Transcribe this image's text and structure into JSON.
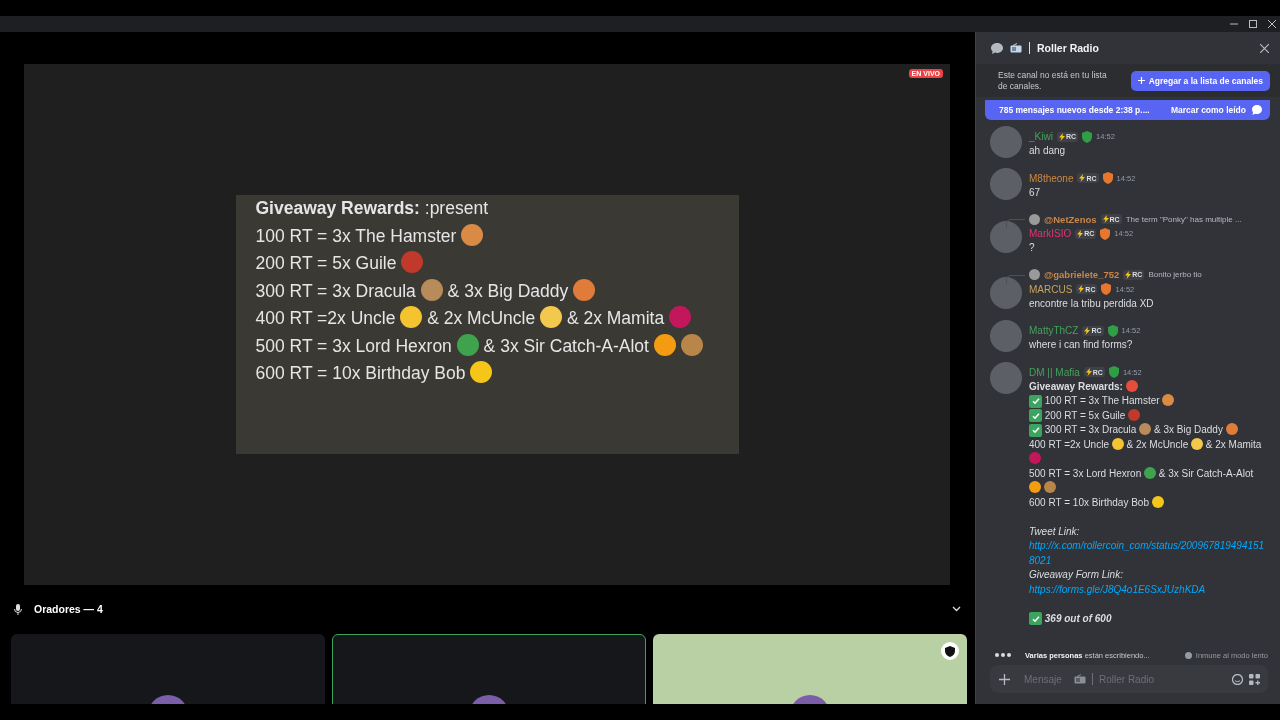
{
  "stage": {
    "live_badge": "EN VIVO",
    "lines": [
      [
        {
          "kind": "bold",
          "text": "Giveaway Rewards:"
        },
        {
          "kind": "text",
          "text": ":present"
        }
      ],
      [
        {
          "kind": "text",
          "text": "100 RT = 3x The Hamster"
        },
        {
          "kind": "emoji",
          "color": "#d98a45"
        }
      ],
      [
        {
          "kind": "text",
          "text": "200 RT = 5x Guile"
        },
        {
          "kind": "emoji",
          "color": "#c0392b"
        }
      ],
      [
        {
          "kind": "text",
          "text": "300 RT = 3x Dracula"
        },
        {
          "kind": "emoji",
          "color": "#b98a5a"
        },
        {
          "kind": "text",
          "text": "& 3x Big Daddy"
        },
        {
          "kind": "emoji",
          "color": "#e07b39"
        }
      ],
      [
        {
          "kind": "text",
          "text": "400 RT =2x Uncle"
        },
        {
          "kind": "emoji",
          "color": "#f4c430"
        },
        {
          "kind": "text",
          "text": "&  2x McUncle"
        },
        {
          "kind": "emoji",
          "color": "#f2c94c"
        },
        {
          "kind": "text",
          "text": "& 2x Mamita"
        },
        {
          "kind": "emoji",
          "color": "#c2185b"
        }
      ],
      [
        {
          "kind": "text",
          "text": "500 RT = 3x Lord Hexron"
        },
        {
          "kind": "emoji",
          "color": "#3fa34d"
        },
        {
          "kind": "text",
          "text": "& 3x Sir Catch-A-Alot"
        },
        {
          "kind": "emoji",
          "color": "#f39c12"
        },
        {
          "kind": "emoji",
          "color": "#b9864a"
        }
      ],
      [
        {
          "kind": "text",
          "text": "600 RT = 10x Birthday Bob"
        },
        {
          "kind": "emoji",
          "color": "#f5c518"
        }
      ]
    ]
  },
  "speakers": {
    "label": "Oradores — 4",
    "tiles": [
      {
        "speaking": false,
        "moderator": false,
        "color": "#16171b"
      },
      {
        "speaking": true,
        "moderator": false,
        "color": "#16171b"
      },
      {
        "speaking": false,
        "moderator": true,
        "color": "#b9d0a5"
      }
    ]
  },
  "chat": {
    "channel": "Roller Radio",
    "notice": "Este canal no está en tu lista de canales.",
    "add_button": "Agregar a la lista de canales",
    "new_messages": "785 mensajes nuevos desde 2:38 p....",
    "mark_read": "Marcar como leído",
    "messages": [
      {
        "author": "_Kiwi",
        "color": "#43a25a",
        "tag": "RC",
        "badge": {
          "color": "#2f9e44"
        },
        "time": "14:52",
        "lines": [
          [
            {
              "kind": "text",
              "text": "ah dang"
            }
          ]
        ]
      },
      {
        "author": "M8theone",
        "color": "#d0883f",
        "tag": "RC",
        "badge": {
          "color": "#e8772e"
        },
        "time": "14:52",
        "lines": [
          [
            {
              "kind": "text",
              "text": "67"
            }
          ]
        ]
      },
      {
        "author": "MarkISIO",
        "color": "#e0356e",
        "tag": "RC",
        "badge": {
          "color": "#e8772e"
        },
        "time": "14:52",
        "reply": {
          "author": "@NetZenos",
          "color": "#c8874a",
          "tag": "RC",
          "text": "The term \"Ponky\" has multiple ..."
        },
        "lines": [
          [
            {
              "kind": "text",
              "text": "?"
            }
          ]
        ]
      },
      {
        "author": "MARCUS",
        "color": "#c9a25b",
        "tag": "RC",
        "badge": {
          "color": "#e8772e"
        },
        "time": "14:52",
        "reply": {
          "author": "@gabrielete_752",
          "color": "#c8874a",
          "tag": "RC",
          "text": "Bonito jerbo tio"
        },
        "lines": [
          [
            {
              "kind": "text",
              "text": "encontre la tribu perdida XD"
            }
          ]
        ]
      },
      {
        "author": "MattyThCZ",
        "color": "#43a25a",
        "tag": "RC",
        "badge": {
          "color": "#2f9e44"
        },
        "time": "14:52",
        "lines": [
          [
            {
              "kind": "text",
              "text": "where i can find forms?"
            }
          ]
        ]
      },
      {
        "author": "DM || Mafia",
        "color": "#43a25a",
        "tag": "RC",
        "badge": {
          "color": "#2f9e44"
        },
        "time": "14:52",
        "lines": [
          [
            {
              "kind": "bold",
              "text": "Giveaway Rewards:"
            },
            {
              "kind": "emoji",
              "color": "#e74c3c"
            }
          ],
          [
            {
              "kind": "check"
            },
            {
              "kind": "text",
              "text": "100 RT = 3x The Hamster"
            },
            {
              "kind": "emoji",
              "color": "#d98a45"
            }
          ],
          [
            {
              "kind": "check"
            },
            {
              "kind": "text",
              "text": "200 RT = 5x Guile"
            },
            {
              "kind": "emoji",
              "color": "#c0392b"
            }
          ],
          [
            {
              "kind": "check"
            },
            {
              "kind": "text",
              "text": "300 RT = 3x Dracula"
            },
            {
              "kind": "emoji",
              "color": "#b98a5a"
            },
            {
              "kind": "text",
              "text": "& 3x Big Daddy"
            },
            {
              "kind": "emoji",
              "color": "#e07b39"
            }
          ],
          [
            {
              "kind": "text",
              "text": "400 RT =2x Uncle"
            },
            {
              "kind": "emoji",
              "color": "#f4c430"
            },
            {
              "kind": "text",
              "text": "&  2x McUncle"
            },
            {
              "kind": "emoji",
              "color": "#f2c94c"
            },
            {
              "kind": "text",
              "text": "& 2x Mamita"
            },
            {
              "kind": "emoji",
              "color": "#c2185b"
            }
          ],
          [
            {
              "kind": "text",
              "text": "500 RT = 3x Lord Hexron"
            },
            {
              "kind": "emoji",
              "color": "#3fa34d"
            },
            {
              "kind": "text",
              "text": "& 3x Sir Catch-A-Alot"
            },
            {
              "kind": "emoji",
              "color": "#f39c12"
            },
            {
              "kind": "emoji",
              "color": "#b9864a"
            }
          ],
          [
            {
              "kind": "text",
              "text": "600 RT = 10x Birthday Bob"
            },
            {
              "kind": "emoji",
              "color": "#f5c518"
            }
          ],
          [
            {
              "kind": "gap"
            }
          ],
          [
            {
              "kind": "italic",
              "text": "Tweet Link:"
            }
          ],
          [
            {
              "kind": "link",
              "text": "http://x.com/rollercoin_com/status/2009678194941518021"
            }
          ],
          [
            {
              "kind": "italic",
              "text": "Giveaway Form Link:"
            }
          ],
          [
            {
              "kind": "link",
              "text": "https://forms.gle/J8Q4o1E6SxJUzhKDA"
            }
          ],
          [
            {
              "kind": "gap"
            }
          ],
          [
            {
              "kind": "check"
            },
            {
              "kind": "bolditalic",
              "text": "369 out of 600"
            }
          ]
        ]
      }
    ],
    "typing": "**Varias personas** están escribiendo...",
    "slowmode": "Inmune al modo lento",
    "input": {
      "placeholder": "Mensaje",
      "channel": "Roller Radio"
    }
  }
}
